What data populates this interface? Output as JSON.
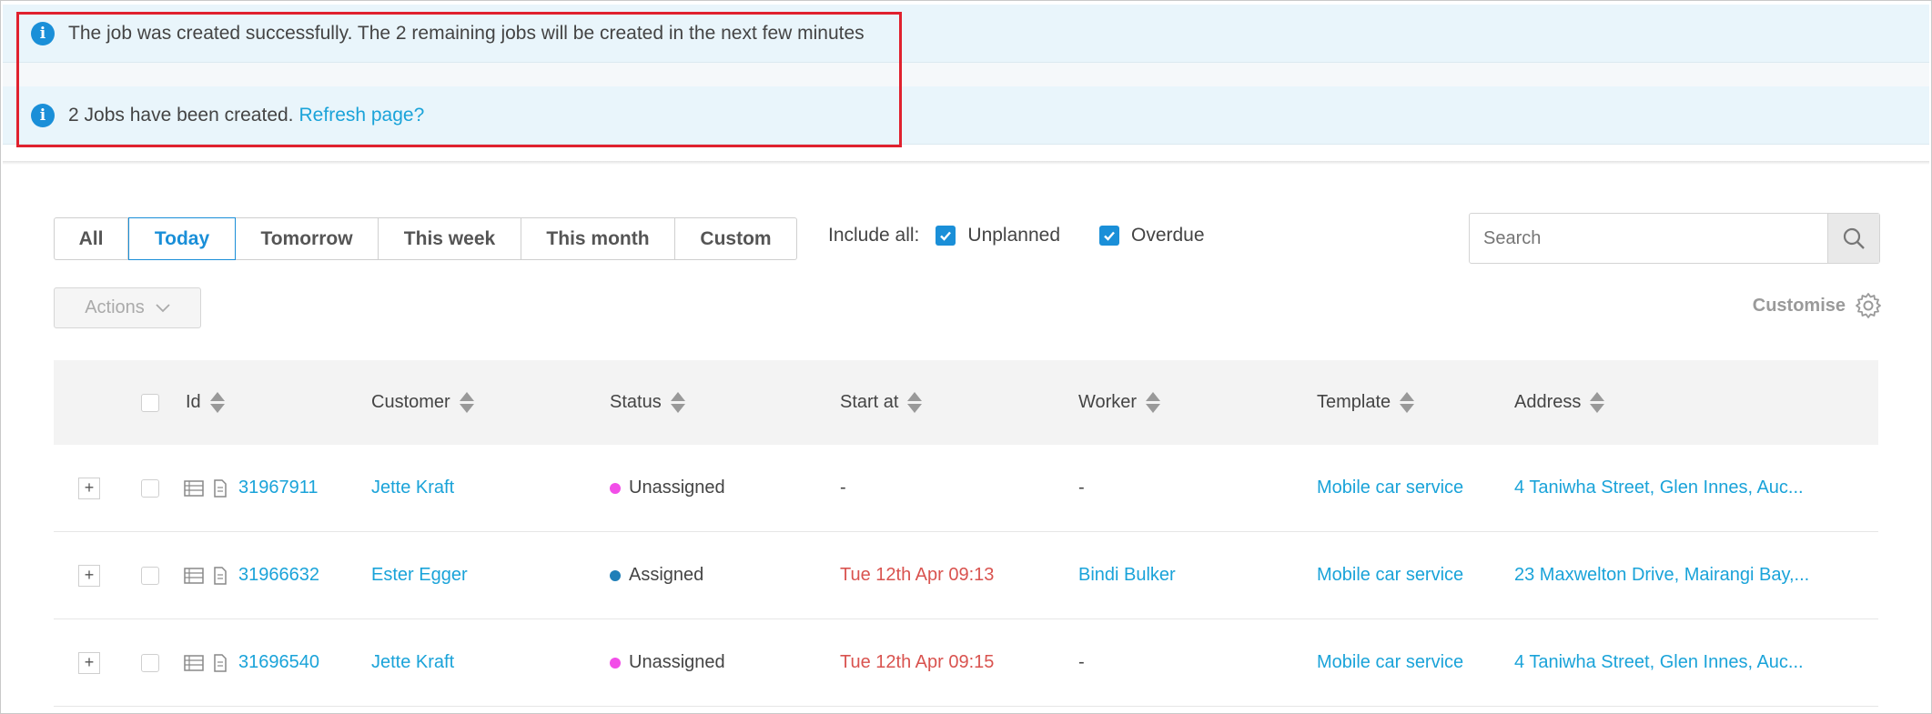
{
  "notifications": [
    {
      "text": "The job was created successfully. The 2 remaining jobs will be created in the next few minutes",
      "link": ""
    },
    {
      "text": "2 Jobs have been created.",
      "link": "Refresh page?"
    }
  ],
  "filters": {
    "tabs": [
      "All",
      "Today",
      "Tomorrow",
      "This week",
      "This month",
      "Custom"
    ],
    "active": "Today",
    "include_label": "Include all:",
    "unplanned_label": "Unplanned",
    "overdue_label": "Overdue"
  },
  "search": {
    "placeholder": "Search"
  },
  "toolbar": {
    "actions_label": "Actions",
    "customise_label": "Customise"
  },
  "table": {
    "columns": [
      "Id",
      "Customer",
      "Status",
      "Start at",
      "Worker",
      "Template",
      "Address"
    ],
    "rows": [
      {
        "id": "31967911",
        "customer": "Jette Kraft",
        "status": "Unassigned",
        "status_color": "#f24ee8",
        "start": "-",
        "worker": "-",
        "template": "Mobile car service",
        "address": "4 Taniwha Street, Glen Innes, Auc..."
      },
      {
        "id": "31966632",
        "customer": "Ester Egger",
        "status": "Assigned",
        "status_color": "#1f7fb8",
        "start": "Tue 12th Apr 09:13",
        "worker": "Bindi Bulker",
        "template": "Mobile car service",
        "address": "23 Maxwelton Drive, Mairangi Bay,..."
      },
      {
        "id": "31696540",
        "customer": "Jette Kraft",
        "status": "Unassigned",
        "status_color": "#f24ee8",
        "start": "Tue 12th Apr 09:15",
        "worker": "-",
        "template": "Mobile car service",
        "address": "4 Taniwha Street, Glen Innes, Auc..."
      }
    ]
  },
  "colors": {
    "accent": "#1a8fd8",
    "link": "#1aa3d9",
    "highlight": "#e0212e",
    "overdue": "#d9534f"
  }
}
